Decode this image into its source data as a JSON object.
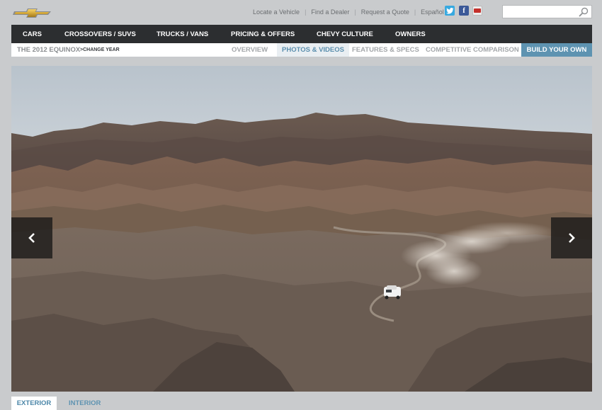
{
  "header": {
    "util_links": [
      "Locate a Vehicle",
      "Find a Dealer",
      "Request a Quote",
      "Español"
    ],
    "search": {
      "value": "",
      "placeholder": ""
    },
    "social": [
      "twitter-icon",
      "facebook-icon",
      "youtube-icon"
    ]
  },
  "main_nav": {
    "items": [
      "CARS",
      "CROSSOVERS / SUVS",
      "TRUCKS / VANS",
      "PRICING & OFFERS",
      "CHEVY CULTURE",
      "OWNERS"
    ]
  },
  "sub_nav": {
    "model": "THE 2012 EQUINOX",
    "change_year": ">CHANGE YEAR",
    "tabs": [
      "OVERVIEW",
      "PHOTOS & VIDEOS",
      "FEATURES & SPECS",
      "COMPETITIVE COMPARISON"
    ],
    "active_tab": "PHOTOS & VIDEOS",
    "build_label": "BUILD YOUR OWN"
  },
  "gallery": {
    "prev_icon": "chevron-left-icon",
    "next_icon": "chevron-right-icon",
    "tabs": [
      "EXTERIOR",
      "INTERIOR"
    ],
    "active_tab": "EXTERIOR"
  },
  "colors": {
    "nav_bg": "#2c2e30",
    "accent": "#5e93b1",
    "page_bg": "#c9cbcd",
    "brand_gold": "#d4a93a"
  }
}
